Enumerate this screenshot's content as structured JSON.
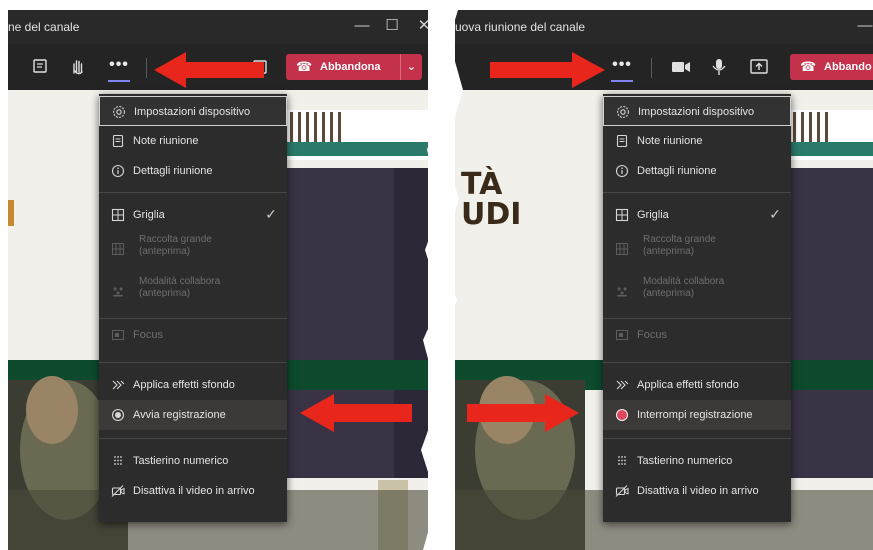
{
  "left": {
    "window_title": "ne del canale",
    "leave_label": "Abbandona",
    "more_label": "•••",
    "menu": [
      {
        "label": "Impostazioni dispositivo",
        "icon": "gear-icon"
      },
      {
        "label": "Note riunione",
        "icon": "notes-icon"
      },
      {
        "label": "Dettagli riunione",
        "icon": "info-icon"
      },
      {
        "label": "Griglia",
        "icon": "grid-icon",
        "checked": "✓"
      },
      {
        "label": "Raccolta grande",
        "sub": "(anteprima)",
        "icon": "large-gallery-icon",
        "disabled": true
      },
      {
        "label": "Modalità collabora",
        "sub": "(anteprima)",
        "icon": "together-mode-icon",
        "disabled": true
      },
      {
        "label": "Focus",
        "icon": "focus-icon",
        "disabled": true
      },
      {
        "label": "Applica effetti sfondo",
        "icon": "background-effects-icon"
      },
      {
        "label": "Avvia registrazione",
        "icon": "record-icon"
      },
      {
        "label": "Tastierino numerico",
        "icon": "dialpad-icon"
      },
      {
        "label": "Disattiva il video in arrivo",
        "icon": "video-off-icon"
      }
    ]
  },
  "right": {
    "window_title": "uova riunione del canale",
    "leave_label": "Abbando",
    "more_label": "•••",
    "menu": [
      {
        "label": "Impostazioni dispositivo",
        "icon": "gear-icon"
      },
      {
        "label": "Note riunione",
        "icon": "notes-icon"
      },
      {
        "label": "Dettagli riunione",
        "icon": "info-icon"
      },
      {
        "label": "Griglia",
        "icon": "grid-icon",
        "checked": "✓"
      },
      {
        "label": "Raccolta grande",
        "sub": "(anteprima)",
        "icon": "large-gallery-icon",
        "disabled": true
      },
      {
        "label": "Modalità collabora",
        "sub": "(anteprima)",
        "icon": "together-mode-icon",
        "disabled": true
      },
      {
        "label": "Focus",
        "icon": "focus-icon",
        "disabled": true
      },
      {
        "label": "Applica effetti sfondo",
        "icon": "background-effects-icon"
      },
      {
        "label": "Interrompi registrazione",
        "icon": "stop-recording-icon"
      },
      {
        "label": "Tastierino numerico",
        "icon": "dialpad-icon"
      },
      {
        "label": "Disattiva il video in arrivo",
        "icon": "video-off-icon"
      }
    ]
  },
  "background_text": {
    "line1": "TÀ",
    "line2": "UDI"
  },
  "colors": {
    "accent": "#7f85f5",
    "leave": "#c4314b",
    "arrow": "#e8261c",
    "stop_recording": "#e0475e"
  }
}
